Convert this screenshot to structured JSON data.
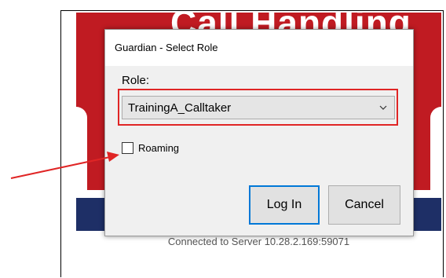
{
  "background": {
    "app_title": "Call Handling",
    "status_text": "Connected to Server 10.28.2.169:59071"
  },
  "dialog": {
    "title": "Guardian - Select Role",
    "role_label": "Role:",
    "role_selected": "TrainingA_Calltaker",
    "roaming_label": "Roaming",
    "roaming_checked": false,
    "login_label": "Log In",
    "cancel_label": "Cancel"
  },
  "colors": {
    "highlight": "#e02525",
    "arrow": "#e02525",
    "default_button_border": "#0078d7",
    "app_red": "#c01b22",
    "app_navy": "#1e2f66"
  },
  "icons": {
    "dropdown": "chevron-down-icon",
    "annotation": "arrow-icon"
  }
}
